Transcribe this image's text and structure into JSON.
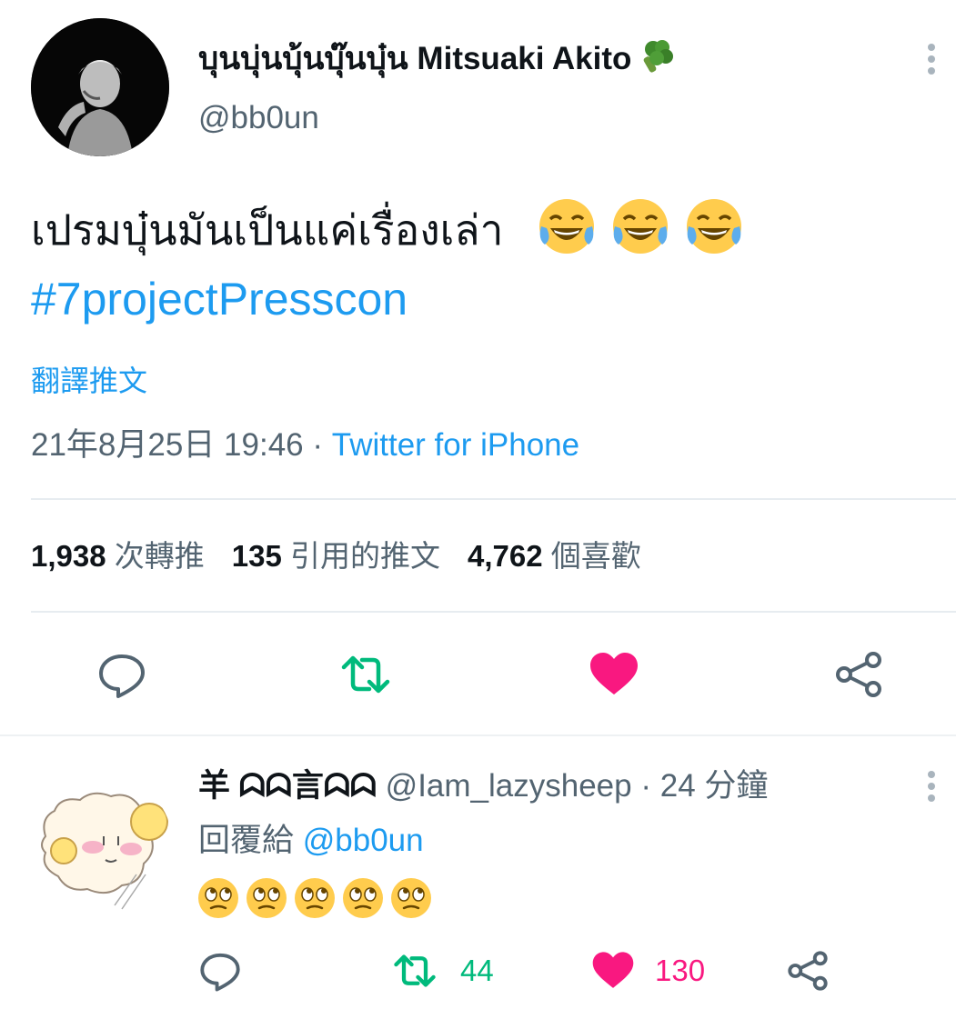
{
  "main_tweet": {
    "display_name": "บุนบุ่นบุ้นบุ๊นบุ๋น Mitsuaki Akito",
    "name_emoji": "broccoli-emoji",
    "handle": "@bb0un",
    "text": "เปรมบุ๋นมันเป็นแค่เรื่องเล่า",
    "text_emojis": [
      "face-with-tears-of-joy",
      "face-with-tears-of-joy",
      "face-with-tears-of-joy"
    ],
    "hashtag": "#7projectPresscon",
    "translate_label": "翻譯推文",
    "date_time": "21年8月25日 19:46",
    "meta_separator": "·",
    "source": "Twitter for iPhone",
    "stats": {
      "retweets_count": "1,938",
      "retweets_label": "次轉推",
      "quotes_count": "135",
      "quotes_label": "引用的推文",
      "likes_count": "4,762",
      "likes_label": "個喜歡"
    },
    "actions": [
      "reply-icon",
      "retweet-icon",
      "like-icon",
      "share-icon"
    ],
    "liked": true
  },
  "reply": {
    "display_name": "羊 ᗣᗣ言ᗣᗣ",
    "handle": "@Iam_lazysheep",
    "separator": "·",
    "time_ago": "24 分鐘",
    "replying_to_label": "回覆給",
    "replying_to_handle": "@bb0un",
    "emojis": [
      "face-with-rolling-eyes",
      "face-with-rolling-eyes",
      "face-with-rolling-eyes",
      "face-with-rolling-eyes",
      "face-with-rolling-eyes"
    ],
    "retweet_count": "44",
    "like_count": "130"
  },
  "colors": {
    "accent_blue": "#1d9bf0",
    "retweet_green": "#00ba7c",
    "like_red": "#f91880",
    "secondary_text": "#536471"
  }
}
